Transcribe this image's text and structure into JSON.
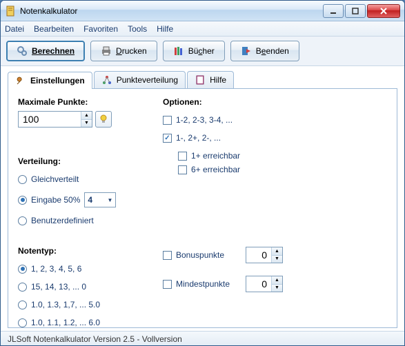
{
  "window": {
    "title": "Notenkalkulator"
  },
  "menubar": [
    "Datei",
    "Bearbeiten",
    "Favoriten",
    "Tools",
    "Hilfe"
  ],
  "toolbar": {
    "berechnen": "Berechnen",
    "drucken": "Drucken",
    "buecher": "Bücher",
    "beenden": "Beenden"
  },
  "tabs": {
    "einstellungen": "Einstellungen",
    "punkteverteilung": "Punkteverteilung",
    "hilfe": "Hilfe"
  },
  "left": {
    "maxpunkte_label": "Maximale Punkte:",
    "maxpunkte_value": "100",
    "verteilung_label": "Verteilung:",
    "verteilung_options": {
      "gleich": "Gleichverteilt",
      "eingabe": "Eingabe 50%",
      "eingabe_value": "4",
      "benutzer": "Benutzerdefiniert"
    },
    "notentyp_label": "Notentyp:",
    "notentyp_options": {
      "a": "1, 2, 3, 4, 5, 6",
      "b": "15, 14, 13, ... 0",
      "c": "1.0, 1.3, 1,7, ... 5.0",
      "d": "1.0, 1.1, 1.2, ... 6.0"
    }
  },
  "right": {
    "optionen_label": "Optionen:",
    "opt1": "1-2, 2-3, 3-4, ...",
    "opt2": "1-, 2+, 2-, ...",
    "opt2a": "1+ erreichbar",
    "opt2b": "6+ erreichbar",
    "bonus_label": "Bonuspunkte",
    "bonus_value": "0",
    "mindest_label": "Mindestpunkte",
    "mindest_value": "0"
  },
  "statusbar": "JLSoft Notenkalkulator Version 2.5 - Vollversion"
}
